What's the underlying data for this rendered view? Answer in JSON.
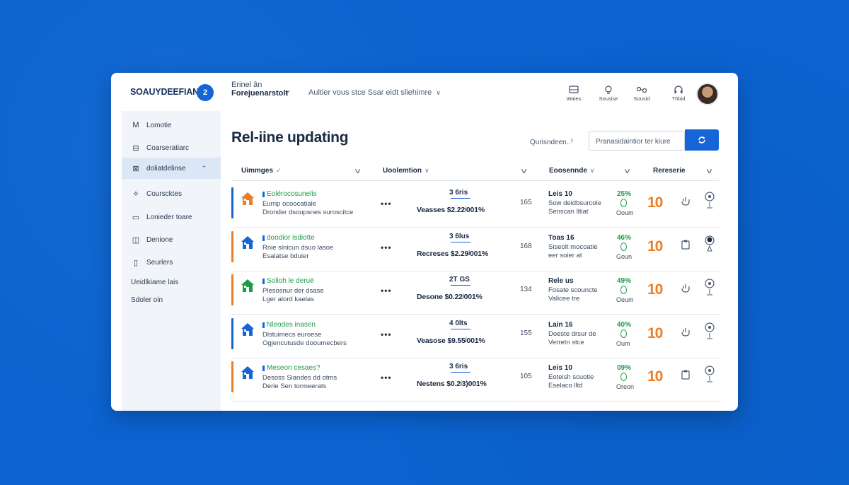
{
  "brand": {
    "name": "SOAUYDEEFIANE",
    "badge": "2"
  },
  "breadcrumb": {
    "top": "Erinel ân",
    "main": "Forejuenarstolt",
    "edit_glyph": "✓"
  },
  "header_search": {
    "text": "Aultier vous stce Ssar eidt sliehimre",
    "chevron": "∨"
  },
  "header_icons": [
    {
      "label": "Waies",
      "icon": "inbox-icon"
    },
    {
      "label": "Sousise",
      "icon": "bulb-icon"
    },
    {
      "label": "Sousid",
      "icon": "glasses-icon"
    },
    {
      "label": "Thbid",
      "icon": "headset-icon"
    }
  ],
  "sidebar": {
    "items": [
      {
        "icon_glyph": "M",
        "label": "Lomotie",
        "active": false
      },
      {
        "icon_glyph": "⊟",
        "label": "Coarseratiarc",
        "active": false
      },
      {
        "icon_glyph": "⊠",
        "label": "doliatdelinse",
        "active": true,
        "tail": "⌃"
      },
      {
        "icon_glyph": "⟡",
        "label": "Courscktes",
        "active": false
      },
      {
        "icon_glyph": "▭",
        "label": "Lonieder toare",
        "active": false
      },
      {
        "icon_glyph": "◫",
        "label": "Denione",
        "active": false
      },
      {
        "icon_glyph": "▯",
        "label": "Seurlers",
        "active": false
      }
    ],
    "link1": "Ueidlkiame lais",
    "link2": "Sdoler oin"
  },
  "main": {
    "title": "Rel-iine updating",
    "filter_label": "Qurisndeen..ˀ",
    "search_placeholder": "Pranasidaintior ter kiure",
    "columns": [
      {
        "label": "Uimmges",
        "mark": "✓"
      },
      {
        "label": "Uoolemtion",
        "mark": "∨"
      },
      {
        "label": "Eoosennde",
        "mark": "∨"
      },
      {
        "label": "Rereserie",
        "mark": ""
      }
    ]
  },
  "rows": [
    {
      "accent": "#1565d8",
      "house_color": "#ef7d22",
      "name": "Eolérocosunelis",
      "d1": "Eurrip ocoocatiale",
      "d2": "Dronder dsoupsnes suroscitce",
      "top": "3 6ris",
      "price": "Veasses $2.22ʲ001%",
      "num": "165",
      "e1": "Leis 10",
      "e2": "Sow deidbsurcole",
      "e3": "Senscan lltiat",
      "pct": "25%",
      "unit": "Ooum",
      "score": "10",
      "act1_icon": "hand-icon",
      "act2_icon": "gauge-icon"
    },
    {
      "accent": "#ef7d22",
      "house_color": "#1565d8",
      "name": "doodior isdiotte",
      "d1": "Rnie slnicun dsuo lasoe",
      "d2": "Esalatse bduier",
      "top": "3 6lus",
      "price": "Recreses $2.29ʲ001%",
      "num": "168",
      "e1": "Toas 16",
      "e2": "Siseolt mocoatie",
      "e3": "eer soier at",
      "pct": "46%",
      "unit": "Goun",
      "score": "10",
      "act1_icon": "clipboard-icon",
      "act2_icon": "pin-icon"
    },
    {
      "accent": "#ef7d22",
      "house_color": "#1f9a4a",
      "name": "Solioh le deruë",
      "d1": "Plesosnur der dsase",
      "d2": "Lger alord kaelas",
      "top": "2T GS",
      "price": "Desone $0.22ʲ001%",
      "num": "134",
      "e1": "Rele us",
      "e2": "Fosate scouncte",
      "e3": "Valicee tre",
      "pct": "49%",
      "unit": "Oeum",
      "score": "10",
      "act1_icon": "hand-icon",
      "act2_icon": "gauge-icon"
    },
    {
      "accent": "#1565d8",
      "house_color": "#1565d8",
      "name": "Nleodes inasen",
      "d1": "Dlstuimecs euroese",
      "d2": "Ogjencutusde dooumecbers",
      "top": "4 0lts",
      "price": "Veasose $9.55ʲ001%",
      "num": "155",
      "e1": "Lain 16",
      "e2": "Doeste drsur de",
      "e3": "Verretn stce",
      "pct": "40%",
      "unit": "Oum",
      "score": "10",
      "act1_icon": "hand-icon",
      "act2_icon": "gauge-icon"
    },
    {
      "accent": "#ef7d22",
      "house_color": "#1565d8",
      "name": "Meseon cesaes?",
      "d1": "Desoss Siandes dd otms",
      "d2": "Derle Sen tormeerats",
      "top": "3 6ris",
      "price": "Nestens $0.2ʲ3)001%",
      "num": "105",
      "e1": "Leis 10",
      "e2": "Eoteish scuotle",
      "e3": "Eselaco lltd",
      "pct": "09%",
      "unit": "Oreon",
      "score": "10",
      "act1_icon": "clipboard-icon",
      "act2_icon": "gauge-icon"
    }
  ],
  "colors": {
    "accent_blue": "#1565d8",
    "accent_orange": "#ef7d22",
    "accent_green": "#1f9a4a",
    "background": "#0b63d1"
  }
}
